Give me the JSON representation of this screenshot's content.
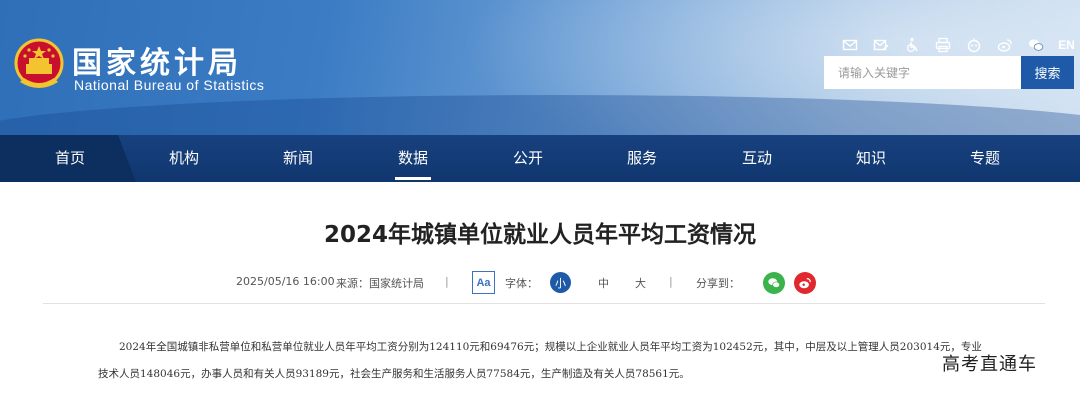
{
  "header": {
    "logo_cn": "国家统计局",
    "logo_en": "National Bureau of Statistics",
    "tools": [
      "mail-icon",
      "mail-edit-icon",
      "accessibility-icon",
      "print-icon",
      "robot-icon",
      "weibo-icon",
      "wechat-icon"
    ],
    "lang": "EN",
    "search_placeholder": "请输入关键字",
    "search_button": "搜索"
  },
  "nav": {
    "items": [
      "首页",
      "机构",
      "新闻",
      "数据",
      "公开",
      "服务",
      "互动",
      "知识",
      "专题"
    ],
    "active": "数据"
  },
  "article": {
    "title": "2024年城镇单位就业人员年平均工资情况",
    "date": "2025/05/16 16:00",
    "source": "来源：国家统计局",
    "font_label": "字体：",
    "font_sizes": [
      "小",
      "中",
      "大"
    ],
    "font_selected": "小",
    "font_icon_text": "Aa",
    "share_label": "分享到：",
    "share_icons": [
      "wechat-share-icon",
      "weibo-share-icon"
    ],
    "body": "2024年全国城镇非私营单位和私营单位就业人员年平均工资分别为124110元和69476元；规模以上企业就业人员年平均工资为102452元，其中，中层及以上管理人员203014元，专业技术人员148046元，办事人员和有关人员93189元，社会生产服务和生活服务人员77584元，生产制造及有关人员78561元。"
  },
  "watermark": "高考直通车",
  "colors": {
    "nav_bg": "#14397a",
    "search_button": "#1f5aa8",
    "font_selected_bg": "#1f5aa8",
    "wechat": "#3bb24a",
    "weibo": "#e0282e"
  }
}
